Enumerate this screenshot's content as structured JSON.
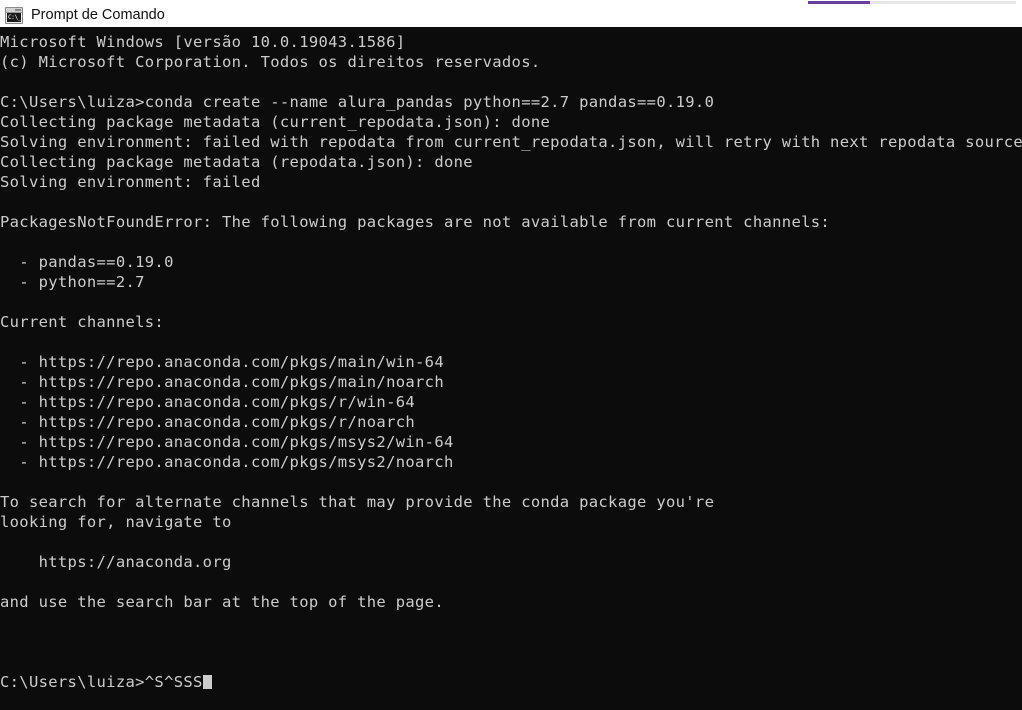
{
  "window": {
    "title": "Prompt de Comando",
    "icon": "console-icon",
    "icon_glyph": "C:\\_",
    "background_color": "#0c0c0c",
    "text_color": "#cccccc",
    "titlebar_color": "#ffffff"
  },
  "top_progress": {
    "accent_color": "#6b3fa0",
    "track_color": "#e8e8e8"
  },
  "terminal": {
    "lines": [
      "Microsoft Windows [versão 10.0.19043.1586]",
      "(c) Microsoft Corporation. Todos os direitos reservados.",
      "",
      "C:\\Users\\luiza>conda create --name alura_pandas python==2.7 pandas==0.19.0",
      "Collecting package metadata (current_repodata.json): done",
      "Solving environment: failed with repodata from current_repodata.json, will retry with next repodata source.",
      "Collecting package metadata (repodata.json): done",
      "Solving environment: failed",
      "",
      "PackagesNotFoundError: The following packages are not available from current channels:",
      "",
      "  - pandas==0.19.0",
      "  - python==2.7",
      "",
      "Current channels:",
      "",
      "  - https://repo.anaconda.com/pkgs/main/win-64",
      "  - https://repo.anaconda.com/pkgs/main/noarch",
      "  - https://repo.anaconda.com/pkgs/r/win-64",
      "  - https://repo.anaconda.com/pkgs/r/noarch",
      "  - https://repo.anaconda.com/pkgs/msys2/win-64",
      "  - https://repo.anaconda.com/pkgs/msys2/noarch",
      "",
      "To search for alternate channels that may provide the conda package you're",
      "looking for, navigate to",
      "",
      "    https://anaconda.org",
      "",
      "and use the search bar at the top of the page.",
      "",
      "",
      "",
      "C:\\Users\\luiza>^S^SSS"
    ],
    "prompt_line_index": 32,
    "cursor_visible": true
  }
}
